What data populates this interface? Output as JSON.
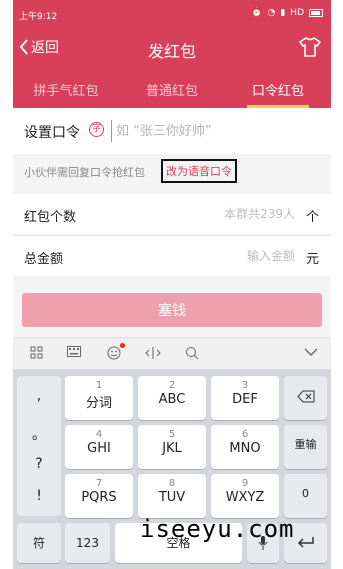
{
  "status": {
    "time": "上午9:12",
    "network": "HD"
  },
  "nav": {
    "back_label": "返回",
    "title": "发红包"
  },
  "tabs": [
    {
      "label": "拼手气红包",
      "active": false
    },
    {
      "label": "普通红包",
      "active": false
    },
    {
      "label": "口令红包",
      "active": true
    }
  ],
  "password": {
    "label": "设置口令",
    "badge": "字",
    "placeholder": "如 “张三你好帅”"
  },
  "hint": {
    "text": "小伙伴需回复口令抢红包",
    "link": "改为语音口令"
  },
  "count": {
    "label": "红包个数",
    "placeholder": "本群共239人",
    "unit": "个"
  },
  "amount": {
    "label": "总金额",
    "placeholder": "输入金额",
    "unit": "元"
  },
  "submit_label": "塞钱",
  "keyboard": {
    "symbols": [
      ",",
      "。",
      "?",
      "!"
    ],
    "keys": [
      {
        "num": "1",
        "letters": "分词"
      },
      {
        "num": "2",
        "letters": "ABC"
      },
      {
        "num": "3",
        "letters": "DEF"
      },
      {
        "num": "4",
        "letters": "GHI"
      },
      {
        "num": "5",
        "letters": "JKL"
      },
      {
        "num": "6",
        "letters": "MNO"
      },
      {
        "num": "7",
        "letters": "PQRS"
      },
      {
        "num": "8",
        "letters": "TUV"
      },
      {
        "num": "9",
        "letters": "WXYZ"
      }
    ],
    "reenter": "重输",
    "zero": "0",
    "sym_key": "符",
    "num123": "123",
    "space": "空格"
  },
  "watermark": "iseeyu.com",
  "colors": {
    "brand": "#d8405a",
    "button_disabled": "#eea1ac",
    "link_red": "#d8405a"
  }
}
